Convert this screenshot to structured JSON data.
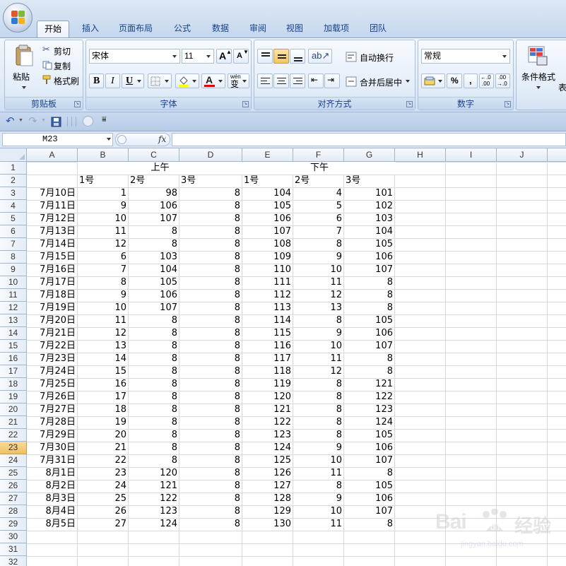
{
  "tabs": [
    "开始",
    "插入",
    "页面布局",
    "公式",
    "数据",
    "审阅",
    "视图",
    "加载项",
    "团队"
  ],
  "ribbon": {
    "clipboard": {
      "label": "剪贴板",
      "paste": "粘贴",
      "cut": "剪切",
      "copy": "复制",
      "format_painter": "格式刷"
    },
    "font": {
      "label": "字体",
      "font_name": "宋体",
      "font_size": "11",
      "grow": "A",
      "shrink": "A",
      "bold": "B",
      "italic": "I",
      "underline": "U",
      "font_color_glyph": "A",
      "phonetic": "wén",
      "phonetic2": "变"
    },
    "alignment": {
      "label": "对齐方式",
      "wrap_text": "自动换行",
      "merge_center": "合并后居中"
    },
    "number": {
      "label": "数字",
      "format": "常规",
      "percent": "%",
      "comma": ",",
      "inc_decimal": ".00",
      "dec_decimal": ".00"
    },
    "styles": {
      "conditional_format": "条件格式",
      "table_partial": "表"
    }
  },
  "formula_bar": {
    "name_box": "M23",
    "fx": "fx",
    "content": ""
  },
  "columns": [
    "A",
    "B",
    "C",
    "D",
    "E",
    "F",
    "G",
    "H",
    "I",
    "J"
  ],
  "rows": [
    "1",
    "2",
    "3",
    "4",
    "5",
    "6",
    "7",
    "8",
    "9",
    "10",
    "11",
    "12",
    "13",
    "14",
    "15",
    "16",
    "17",
    "18",
    "19",
    "20",
    "21",
    "22",
    "23",
    "24",
    "25",
    "26",
    "27",
    "28",
    "29",
    "30",
    "31",
    "32"
  ],
  "selected_row": "23",
  "sheet": {
    "morning_header": "上午",
    "afternoon_header": "下午",
    "sub_headers": [
      "1号",
      "2号",
      "3号",
      "1号",
      "2号",
      "3号"
    ],
    "data": [
      [
        "7月10日",
        "1",
        "98",
        "8",
        "104",
        "4",
        "101"
      ],
      [
        "7月11日",
        "9",
        "106",
        "8",
        "105",
        "5",
        "102"
      ],
      [
        "7月12日",
        "10",
        "107",
        "8",
        "106",
        "6",
        "103"
      ],
      [
        "7月13日",
        "11",
        "8",
        "8",
        "107",
        "7",
        "104"
      ],
      [
        "7月14日",
        "12",
        "8",
        "8",
        "108",
        "8",
        "105"
      ],
      [
        "7月15日",
        "6",
        "103",
        "8",
        "109",
        "9",
        "106"
      ],
      [
        "7月16日",
        "7",
        "104",
        "8",
        "110",
        "10",
        "107"
      ],
      [
        "7月17日",
        "8",
        "105",
        "8",
        "111",
        "11",
        "8"
      ],
      [
        "7月18日",
        "9",
        "106",
        "8",
        "112",
        "12",
        "8"
      ],
      [
        "7月19日",
        "10",
        "107",
        "8",
        "113",
        "13",
        "8"
      ],
      [
        "7月20日",
        "11",
        "8",
        "8",
        "114",
        "8",
        "105"
      ],
      [
        "7月21日",
        "12",
        "8",
        "8",
        "115",
        "9",
        "106"
      ],
      [
        "7月22日",
        "13",
        "8",
        "8",
        "116",
        "10",
        "107"
      ],
      [
        "7月23日",
        "14",
        "8",
        "8",
        "117",
        "11",
        "8"
      ],
      [
        "7月24日",
        "15",
        "8",
        "8",
        "118",
        "12",
        "8"
      ],
      [
        "7月25日",
        "16",
        "8",
        "8",
        "119",
        "8",
        "121"
      ],
      [
        "7月26日",
        "17",
        "8",
        "8",
        "120",
        "8",
        "122"
      ],
      [
        "7月27日",
        "18",
        "8",
        "8",
        "121",
        "8",
        "123"
      ],
      [
        "7月28日",
        "19",
        "8",
        "8",
        "122",
        "8",
        "124"
      ],
      [
        "7月29日",
        "20",
        "8",
        "8",
        "123",
        "8",
        "105"
      ],
      [
        "7月30日",
        "21",
        "8",
        "8",
        "124",
        "9",
        "106"
      ],
      [
        "7月31日",
        "22",
        "8",
        "8",
        "125",
        "10",
        "107"
      ],
      [
        "8月1日",
        "23",
        "120",
        "8",
        "126",
        "11",
        "8"
      ],
      [
        "8月2日",
        "24",
        "121",
        "8",
        "127",
        "8",
        "105"
      ],
      [
        "8月3日",
        "25",
        "122",
        "8",
        "128",
        "9",
        "106"
      ],
      [
        "8月4日",
        "26",
        "123",
        "8",
        "129",
        "10",
        "107"
      ],
      [
        "8月5日",
        "27",
        "124",
        "8",
        "130",
        "11",
        "8"
      ]
    ]
  },
  "watermark": {
    "brand": "Bai",
    "brand2": "经验",
    "url": "jingyan.baidu.com"
  },
  "colors": {
    "ribbon_blue": "#dfeaf7",
    "tab_text": "#15428b",
    "grid_line": "#d4dae6",
    "selected_header": "#f1c15f"
  }
}
